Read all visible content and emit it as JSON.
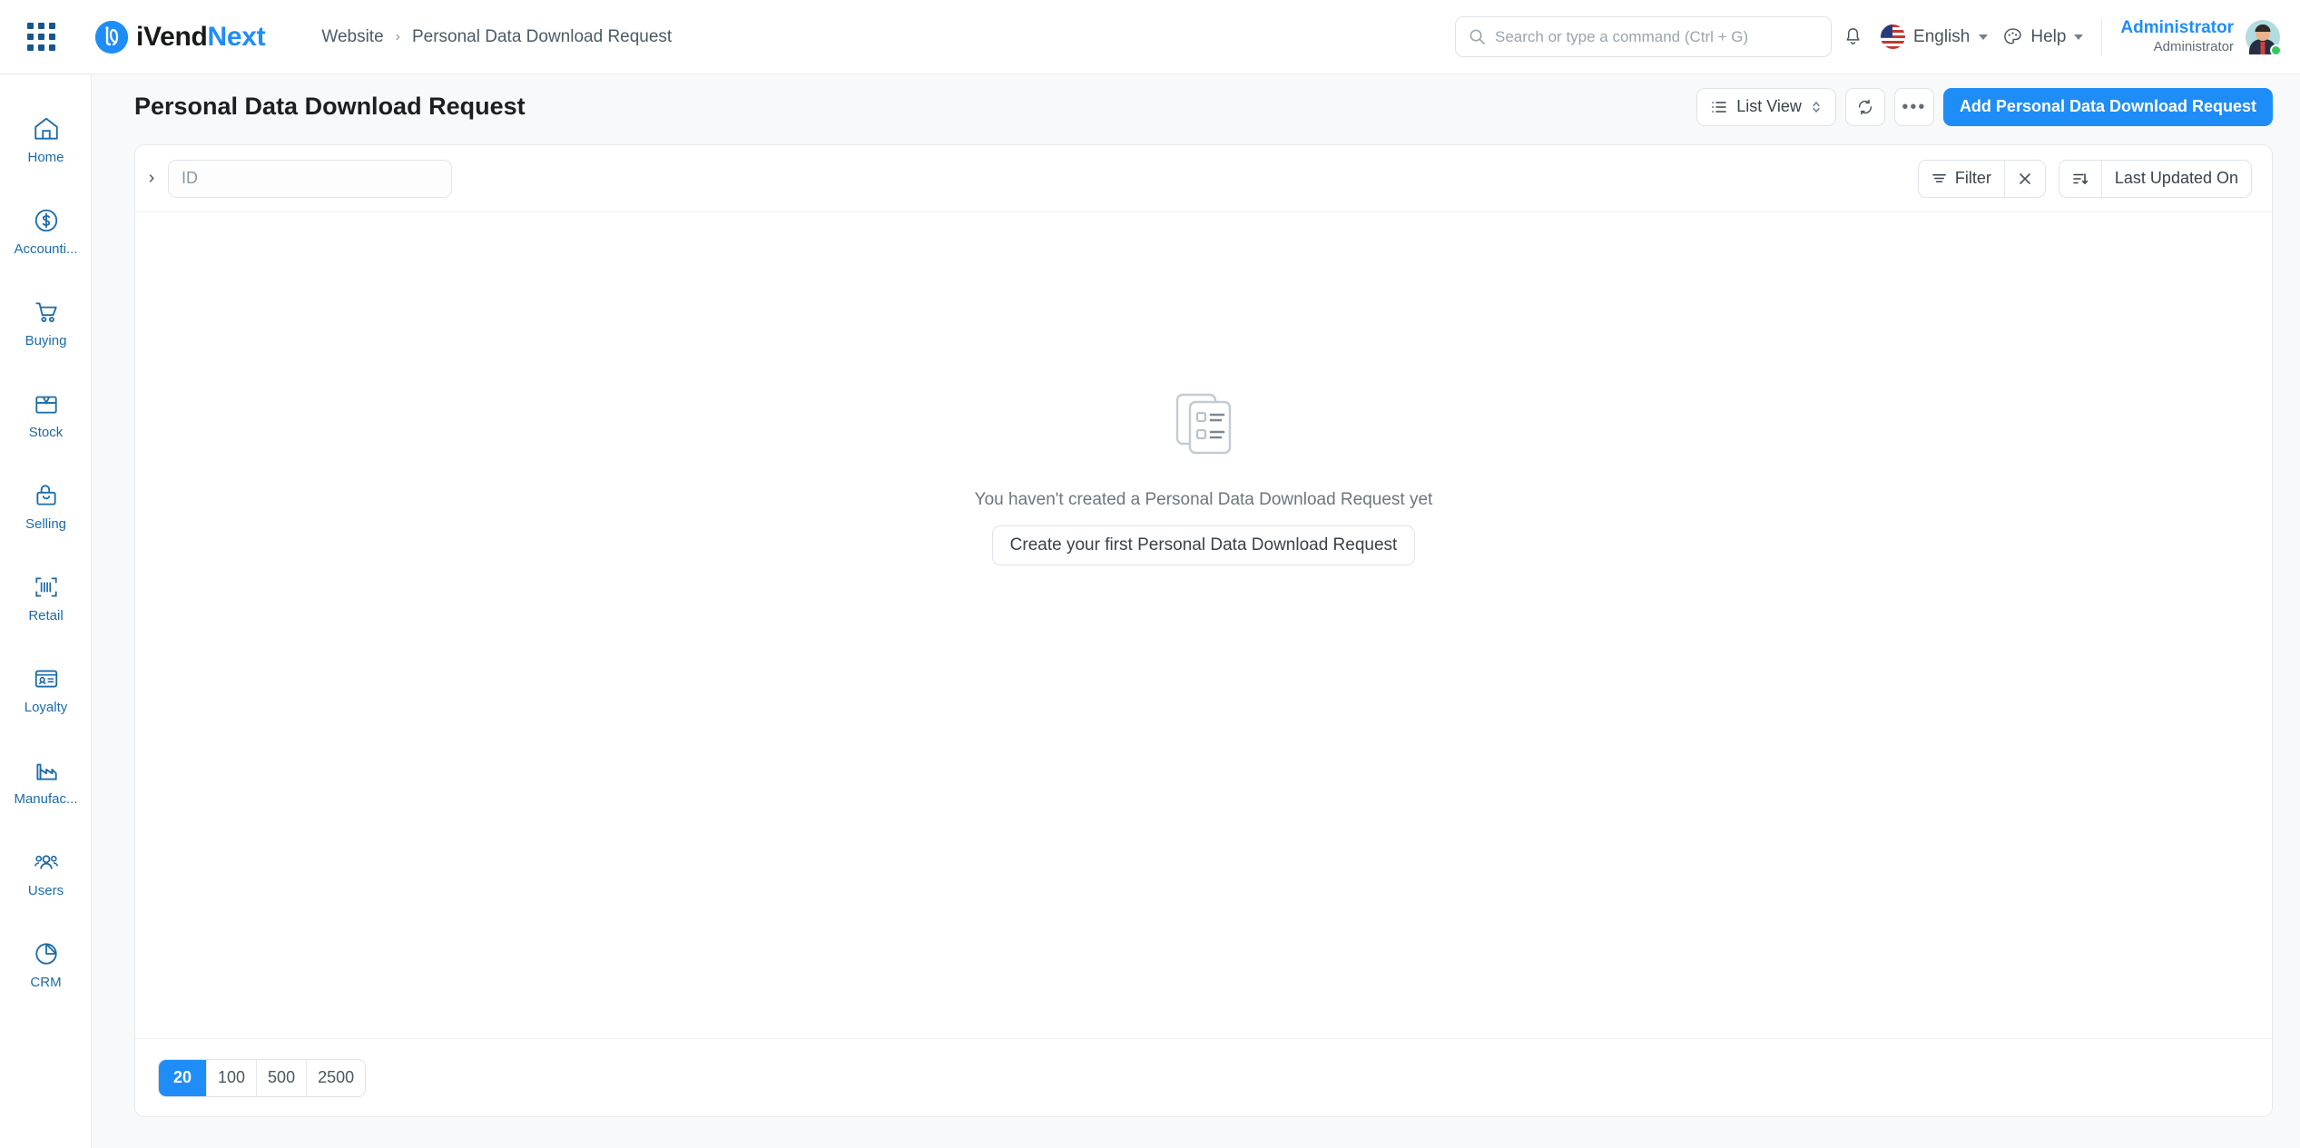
{
  "navbar": {
    "apps_icon": "apps-grid-icon",
    "brand": {
      "part1": "iVend",
      "part2": "Next",
      "logo_icon": "ivendnext-logo-icon"
    },
    "breadcrumb": {
      "parent": "Website",
      "separator": "›",
      "current": "Personal Data Download Request"
    },
    "search": {
      "placeholder": "Search or type a command (Ctrl + G)",
      "value": "",
      "icon": "search-icon"
    },
    "notifications_icon": "bell-icon",
    "language": {
      "label": "English",
      "flag": "us-flag-icon",
      "chevron": "chevron-down-icon"
    },
    "help": {
      "label": "Help",
      "icon": "palette-icon",
      "chevron": "chevron-down-icon"
    },
    "user": {
      "name": "Administrator",
      "role": "Administrator",
      "avatar": "user-avatar",
      "status": "online"
    }
  },
  "sidebar": {
    "items": [
      {
        "label": "Home",
        "icon": "home-icon"
      },
      {
        "label": "Accounti...",
        "icon": "dollar-coin-icon"
      },
      {
        "label": "Buying",
        "icon": "shopping-cart-icon"
      },
      {
        "label": "Stock",
        "icon": "box-icon"
      },
      {
        "label": "Selling",
        "icon": "shopping-bag-icon"
      },
      {
        "label": "Retail",
        "icon": "barcode-icon"
      },
      {
        "label": "Loyalty",
        "icon": "id-card-icon"
      },
      {
        "label": "Manufac...",
        "icon": "factory-icon"
      },
      {
        "label": "Users",
        "icon": "people-icon"
      },
      {
        "label": "CRM",
        "icon": "pie-chart-icon"
      }
    ]
  },
  "page": {
    "title": "Personal Data Download Request",
    "actions": {
      "list_view": {
        "label": "List View",
        "icon": "list-icon",
        "chevron": "updown-chevron-icon"
      },
      "refresh": {
        "icon": "refresh-icon"
      },
      "more": {
        "icon": "ellipsis-icon",
        "label": "•••"
      },
      "add": {
        "label": "Add Personal Data Download Request"
      }
    }
  },
  "list": {
    "expand_toggle": {
      "icon": "chevron-right-icon",
      "glyph": "›"
    },
    "id_filter": {
      "placeholder": "ID",
      "value": ""
    },
    "filter_button": {
      "label": "Filter",
      "icon": "filter-icon"
    },
    "clear_filter": {
      "label": "×",
      "icon": "close-icon"
    },
    "sort": {
      "label": "Last Updated On",
      "icon": "sort-descending-icon"
    },
    "empty": {
      "icon": "empty-documents-icon",
      "message": "You haven't created a Personal Data Download Request yet",
      "cta_label": "Create your first Personal Data Download Request"
    },
    "page_sizes": [
      "20",
      "100",
      "500",
      "2500"
    ],
    "active_page_size": "20"
  },
  "colors": {
    "primary": "#1f8df8",
    "sidebar_text": "#1b6ba8",
    "page_bg": "#f8f9fa",
    "border": "#e6e9ec",
    "status_online": "#36c85c"
  }
}
